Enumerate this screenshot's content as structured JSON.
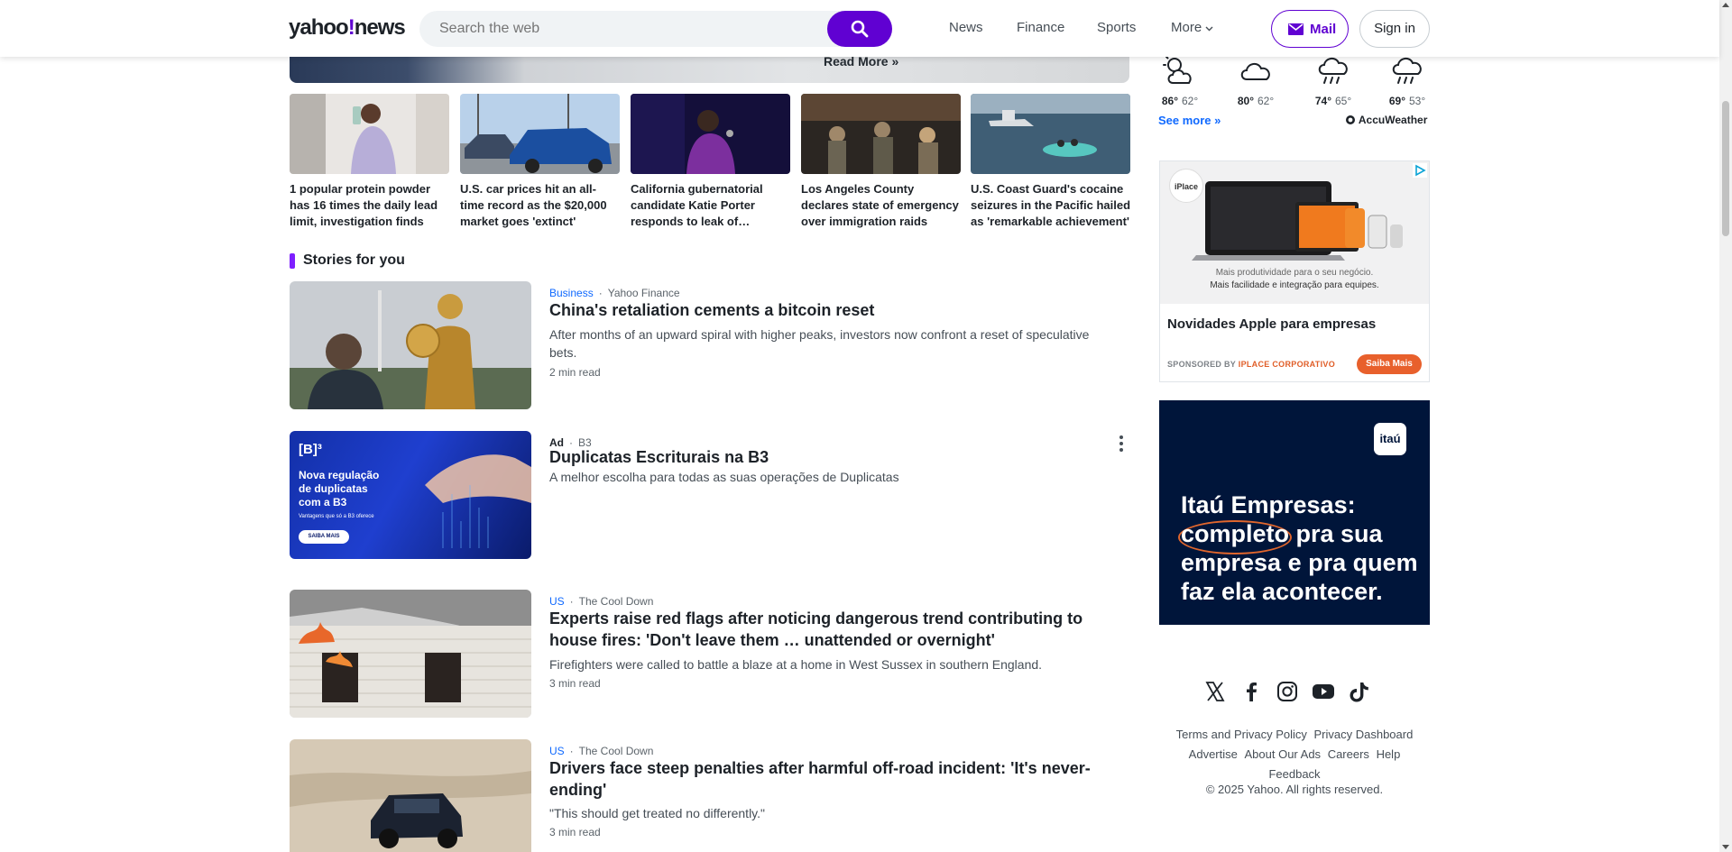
{
  "header": {
    "logo_prefix": "yahoo",
    "logo_bang": "!",
    "logo_suffix": "news",
    "search_placeholder": "Search the web",
    "nav": [
      "News",
      "Finance",
      "Sports",
      "More"
    ],
    "mail_label": "Mail",
    "signin_label": "Sign in"
  },
  "hero": {
    "read_more": "Read More »"
  },
  "thumbnails": [
    {
      "caption": "1 popular protein powder has 16 times the daily lead limit, investigation finds"
    },
    {
      "caption": "U.S. car prices hit an all-time record as the $20,000 market goes 'extinct'"
    },
    {
      "caption": "California gubernatorial candidate Katie Porter responds to leak of…"
    },
    {
      "caption": "Los Angeles County declares state of emergency over immigration raids"
    },
    {
      "caption": "U.S. Coast Guard's cocaine seizures in the Pacific hailed as 'remarkable achievement'"
    }
  ],
  "section_title": "Stories for you",
  "stories": [
    {
      "category": "Business",
      "source": "Yahoo Finance",
      "title": "China's retaliation cements a bitcoin reset",
      "description": "After months of an upward spiral with higher peaks, investors now confront a reset of speculative bets.",
      "read_time": "2 min read"
    },
    {
      "category": "Ad",
      "source": "B3",
      "title": "Duplicatas Escriturais na B3",
      "description": "A melhor escolha para todas as suas operações de Duplicatas",
      "ad_image_text": {
        "brand": "[B]³",
        "line1": "Nova regulação",
        "line2": "de duplicatas",
        "line3": "com a B3",
        "small": "Vantagens que só a B3 oferece",
        "button": "SAIBA MAIS"
      }
    },
    {
      "category": "US",
      "source": "The Cool Down",
      "title": "Experts raise red flags after noticing dangerous trend contributing to house fires: 'Don't leave them … unattended or overnight'",
      "description": "Firefighters were called to battle a blaze at a home in West Sussex in southern England.",
      "read_time": "3 min read"
    },
    {
      "category": "US",
      "source": "The Cool Down",
      "title": "Drivers face steep penalties after harmful off-road incident: 'It's never-ending'",
      "description": "\"This should get treated no differently.\"",
      "read_time": "3 min read"
    }
  ],
  "weather": {
    "days": [
      {
        "icon": "partly-sunny-icon",
        "high": "86°",
        "low": "62°"
      },
      {
        "icon": "cloud-icon",
        "high": "80°",
        "low": "62°"
      },
      {
        "icon": "rain-icon",
        "high": "74°",
        "low": "65°"
      },
      {
        "icon": "rain-icon",
        "high": "69°",
        "low": "53°"
      }
    ],
    "see_more": "See more »",
    "provider": "AccuWeather"
  },
  "ad_iplace": {
    "brand": "iPlace",
    "image_line1": "Mais produtividade para o seu negócio.",
    "image_line2": "Mais facilidade e integração para equipes.",
    "headline": "Novidades Apple para empresas",
    "sponsored_prefix": "SPONSORED BY",
    "sponsor": "IPLACE CORPORATIVO",
    "cta": "Saiba Mais"
  },
  "ad_itau": {
    "logo": "itaú",
    "copy": "Itaú Empresas: completo pra sua empresa e pra quem faz ela acontecer."
  },
  "footer": {
    "links": [
      "Terms and Privacy Policy",
      "Privacy Dashboard",
      "Advertise",
      "About Our Ads",
      "Careers",
      "Help",
      "Feedback"
    ],
    "copyright": "© 2025 Yahoo. All rights reserved."
  },
  "colors": {
    "brand_purple": "#6001d2",
    "section_accent": "#7e1fff",
    "category_blue": "#0f69ff",
    "itau_navy": "#00153a",
    "cta_orange": "#e8602c"
  }
}
